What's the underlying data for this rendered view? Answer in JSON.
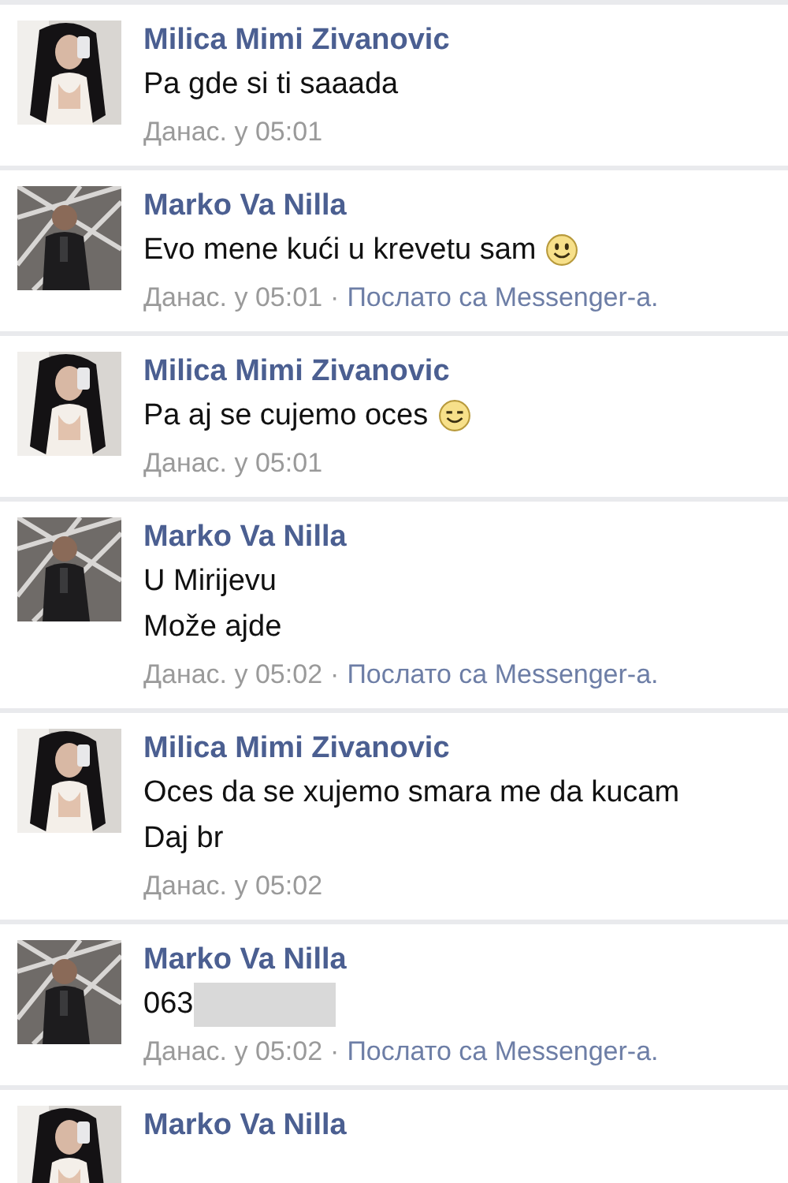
{
  "messages": [
    {
      "sender": "Milica Mimi Zivanovic",
      "avatar": {
        "kind": "picture"
      },
      "lines": [
        {
          "kind": "plain",
          "text": "Pa gde si ti saaada"
        }
      ],
      "time": "Данас. у 05:01"
    },
    {
      "sender": "Marko Va Nilla",
      "avatar": {
        "kind": "picture"
      },
      "lines": [
        {
          "kind": "smile",
          "text": "Evo mene kući u krevetu sam"
        }
      ],
      "time": "Данас. у 05:01",
      "separator": "·",
      "via": "Послато са Messenger-а."
    },
    {
      "sender": "Milica Mimi Zivanovic",
      "avatar": {
        "kind": "picture"
      },
      "lines": [
        {
          "kind": "grin",
          "text": "Pa aj se cujemo oces"
        }
      ],
      "time": "Данас. у 05:01"
    },
    {
      "sender": "Marko Va Nilla",
      "avatar": {
        "kind": "picture"
      },
      "lines": [
        {
          "kind": "plain",
          "text": "U Mirijevu"
        },
        {
          "kind": "plain",
          "text": "Može ajde"
        }
      ],
      "time": "Данас. у 05:02",
      "separator": "·",
      "via": "Послато са Messenger-а."
    },
    {
      "sender": "Milica Mimi Zivanovic",
      "avatar": {
        "kind": "picture"
      },
      "lines": [
        {
          "kind": "plain",
          "text": "Oces da se xujemo smara me da kucam"
        },
        {
          "kind": "plain",
          "text": "Daj br"
        }
      ],
      "time": "Данас. у 05:02"
    },
    {
      "sender": "Marko Va Nilla",
      "avatar": {
        "kind": "picture"
      },
      "lines": [
        {
          "kind": "plain",
          "text": "063",
          "redacted": true
        }
      ],
      "time": "Данас. у 05:02",
      "separator": "·",
      "via": "Послато са Messenger-а."
    },
    {
      "sender": "Marko Va Nilla",
      "avatar": {
        "kind": "picture"
      }
    }
  ]
}
